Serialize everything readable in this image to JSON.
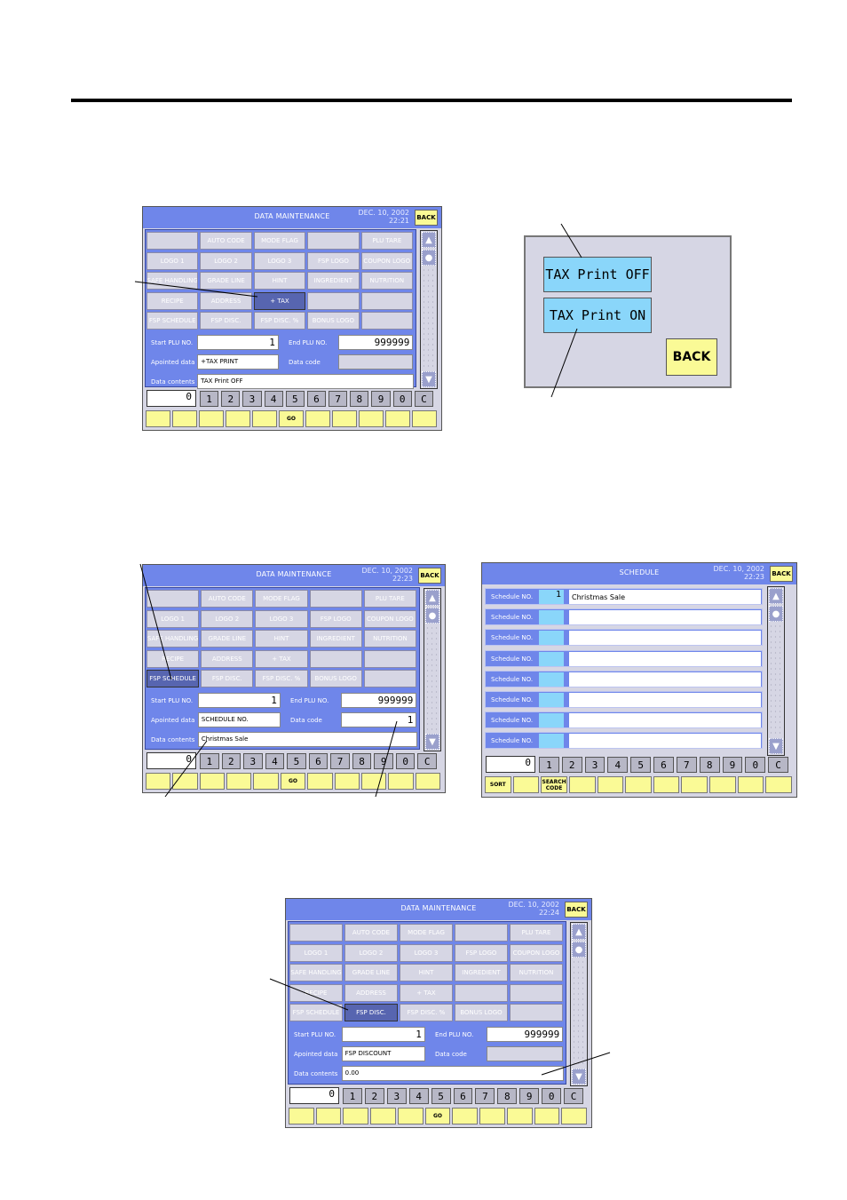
{
  "grid_labels": [
    [
      "",
      "AUTO CODE",
      "MODE FLAG",
      "",
      "PLU TARE"
    ],
    [
      "LOGO 1",
      "LOGO 2",
      "LOGO 3",
      "FSP LOGO",
      "COUPON LOGO"
    ],
    [
      "SAFE HANDLING",
      "GRADE LINE",
      "HINT",
      "INGREDIENT",
      "NUTRITION"
    ],
    [
      "RECIPE",
      "ADDRESS",
      "+ TAX",
      "",
      ""
    ],
    [
      "FSP SCHEDULE",
      "FSP DISC.",
      "FSP DISC. %",
      "BONUS LOGO",
      ""
    ]
  ],
  "common": {
    "back_label": "BACK",
    "start_plu_label": "Start PLU NO.",
    "end_plu_label": "End PLU NO.",
    "appointed_label": "Apointed data",
    "data_code_label": "Data code",
    "data_contents_label": "Data contents",
    "keys": [
      "1",
      "2",
      "3",
      "4",
      "5",
      "6",
      "7",
      "8",
      "9",
      "0",
      "C"
    ],
    "go_label": "GO",
    "scroll_up_icon": "triangle-up",
    "scroll_home_icon": "circle",
    "scroll_down_icon": "triangle-down"
  },
  "screen1": {
    "title": "DATA MAINTENANCE",
    "date": "DEC. 10, 2002",
    "time": "22:21",
    "selected": "+ TAX",
    "start_plu": "1",
    "end_plu": "999999",
    "appointed_data": "+TAX PRINT",
    "data_code": "",
    "data_contents": "TAX Print OFF",
    "entry_value": "0"
  },
  "tax_popup": {
    "option_off": "TAX Print OFF",
    "option_on": "TAX Print ON",
    "back_label": "BACK"
  },
  "screen2": {
    "title": "DATA MAINTENANCE",
    "date": "DEC. 10, 2002",
    "time": "22:23",
    "selected": "FSP SCHEDULE",
    "start_plu": "1",
    "end_plu": "999999",
    "appointed_data": "SCHEDULE NO.",
    "data_code": "1",
    "data_contents": "Christmas Sale",
    "entry_value": "0"
  },
  "schedule_screen": {
    "title": "SCHEDULE",
    "date": "DEC. 10, 2002",
    "time": "22:23",
    "row_label": "Schedule NO.",
    "rows": [
      {
        "no": "1",
        "name": "Christmas Sale"
      },
      {
        "no": "",
        "name": ""
      },
      {
        "no": "",
        "name": ""
      },
      {
        "no": "",
        "name": ""
      },
      {
        "no": "",
        "name": ""
      },
      {
        "no": "",
        "name": ""
      },
      {
        "no": "",
        "name": ""
      },
      {
        "no": "",
        "name": ""
      }
    ],
    "entry_value": "0",
    "sort_label": "SORT",
    "search_code_label": "SEARCH CODE"
  },
  "screen3": {
    "title": "DATA MAINTENANCE",
    "date": "DEC. 10, 2002",
    "time": "22:24",
    "selected": "FSP DISC.",
    "start_plu": "1",
    "end_plu": "999999",
    "appointed_data": "FSP DISCOUNT",
    "data_code": "",
    "data_contents": "0.00",
    "entry_value": "0"
  },
  "colors": {
    "title_bar": "#6f86ea",
    "panel": "#d6d6e4",
    "selected_button": "#5765b0",
    "function_key": "#fafa96",
    "popup_button": "#8ad6fa"
  }
}
